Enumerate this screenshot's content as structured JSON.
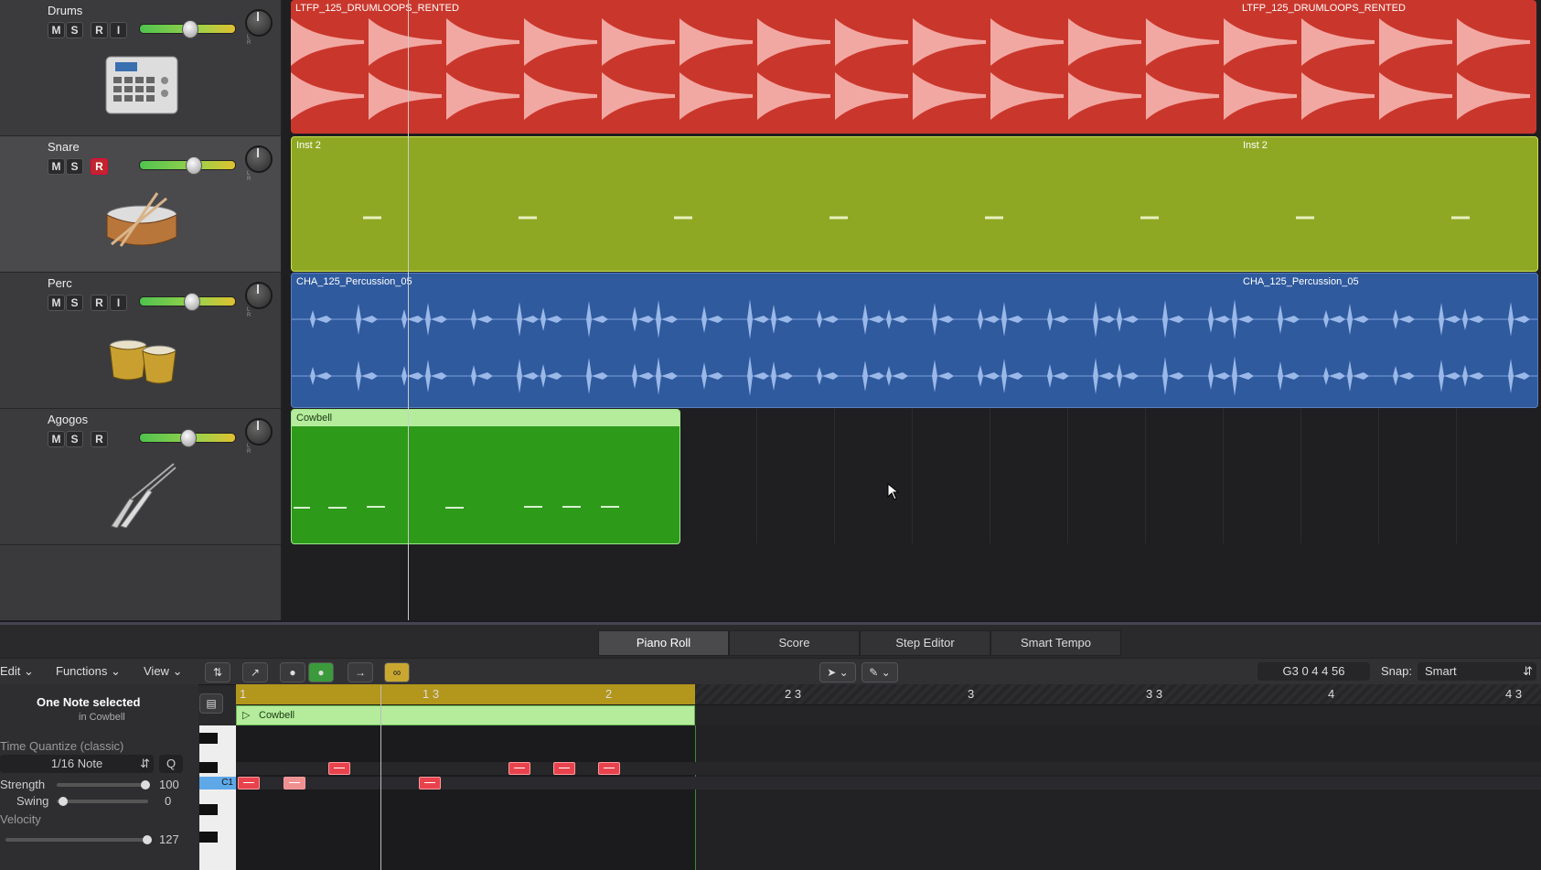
{
  "tracks": [
    {
      "name": "Drums",
      "buttons": [
        "M",
        "S",
        "R",
        "I"
      ],
      "record": false,
      "instrument": "drum-machine-icon"
    },
    {
      "name": "Snare",
      "buttons": [
        "M",
        "S",
        "R"
      ],
      "record": true,
      "instrument": "snare-drum-icon"
    },
    {
      "name": "Perc",
      "buttons": [
        "M",
        "S",
        "R",
        "I"
      ],
      "record": false,
      "instrument": "bongos-icon"
    },
    {
      "name": "Agogos",
      "buttons": [
        "M",
        "S",
        "R"
      ],
      "record": false,
      "instrument": "agogo-bell-icon"
    }
  ],
  "pan_label": "L R",
  "regions": {
    "drums_a": "LTFP_125_DRUMLOOPS_RENTED",
    "drums_b": "LTFP_125_DRUMLOOPS_RENTED",
    "snare_a": "Inst 2",
    "snare_b": "Inst 2",
    "perc_a": "CHA_125_Percussion_05",
    "perc_b": "CHA_125_Percussion_05",
    "cowbell": "Cowbell"
  },
  "colors": {
    "drums": "#c9372c",
    "snare": "#8ea824",
    "perc": "#2f5a9e",
    "cowbell": "#2e9a1a"
  },
  "editor_tabs": [
    "Piano Roll",
    "Score",
    "Step Editor",
    "Smart Tempo"
  ],
  "toolbar": {
    "edit": "Edit",
    "functions": "Functions",
    "view": "View",
    "position": "G3   0 4 4 56",
    "snap_label": "Snap:",
    "snap_value": "Smart"
  },
  "inspector": {
    "selection": "One Note selected",
    "region": "in Cowbell",
    "quantize_label": "Time Quantize (classic)",
    "quantize_value": "1/16 Note",
    "q_button": "Q",
    "strength_label": "Strength",
    "strength_value": "100",
    "swing_label": "Swing",
    "swing_value": "0",
    "velocity_label": "Velocity",
    "velocity_value": "127"
  },
  "ruler": [
    "1",
    "1 3",
    "2",
    "2 3",
    "3",
    "3 3",
    "4",
    "4 3"
  ],
  "roll_region": "Cowbell",
  "key_label": "C1"
}
